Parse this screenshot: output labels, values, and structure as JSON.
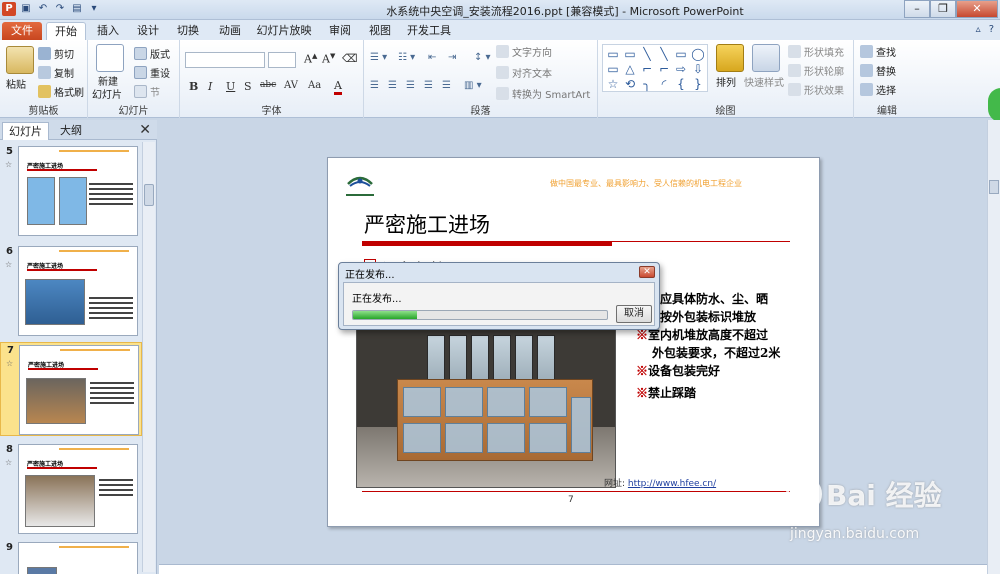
{
  "window": {
    "title": "水系统中央空调_安装流程2016.ppt [兼容模式] - Microsoft PowerPoint"
  },
  "tabs": [
    "文件",
    "开始",
    "插入",
    "设计",
    "切换",
    "动画",
    "幻灯片放映",
    "审阅",
    "视图",
    "开发工具"
  ],
  "ribbon": {
    "clipboard": {
      "paste": "粘贴",
      "cut": "剪切",
      "copy": "复制",
      "format_painter": "格式刷",
      "label": "剪贴板"
    },
    "slides": {
      "new_slide": "新建",
      "new_slide2": "幻灯片",
      "layout": "版式",
      "reset": "重设",
      "section": "节",
      "label": "幻灯片"
    },
    "font": {
      "label": "字体",
      "bold": "B",
      "italic": "I",
      "underline": "U",
      "strike": "S",
      "shadow": "abc",
      "spacing": "AV",
      "case": "Aa",
      "color": "A"
    },
    "paragraph": {
      "label": "段落",
      "text_direction": "文字方向",
      "align_text": "对齐文本",
      "smartart": "转换为 SmartArt"
    },
    "drawing": {
      "label": "绘图",
      "arrange": "排列",
      "quick_styles": "快速样式",
      "fill": "形状填充",
      "outline": "形状轮廓",
      "effects": "形状效果"
    },
    "editing": {
      "label": "编辑",
      "find": "查找",
      "replace": "替换",
      "select": "选择"
    },
    "shapes": [
      "▭",
      "▭",
      "╲",
      "╲",
      "▭",
      "◯",
      "▭",
      "△",
      "⌐",
      "⌐",
      "⇨",
      "⇩",
      "☆",
      "⟲",
      "╮",
      "◜",
      "{",
      "}"
    ]
  },
  "left_panel": {
    "tabs": [
      "幻灯片",
      "大纲"
    ],
    "slides": [
      {
        "number": "5",
        "title": "严密施工进场"
      },
      {
        "number": "6",
        "title": "严密施工进场"
      },
      {
        "number": "7",
        "title": "严密施工进场"
      },
      {
        "number": "8",
        "title": "严密施工进场"
      },
      {
        "number": "9",
        "title": ""
      }
    ]
  },
  "slide": {
    "slogan": "做中国最专业、最具影响力、受人信赖的机电工程企业",
    "title": "严密施工进场",
    "subheading": "设备保护",
    "bullets": [
      {
        "marker": "",
        "text": "堆放应具体防水、尘、晒"
      },
      {
        "marker": "",
        "text": "设备按外包装标识堆放"
      },
      {
        "marker": "※",
        "text": "室内机堆放高度不超过"
      },
      {
        "marker": "",
        "text": "外包装要求，不超过2米"
      },
      {
        "marker": "※",
        "text": "设备包装完好"
      },
      {
        "marker": "※",
        "text": "禁止踩踏"
      }
    ],
    "link_prefix": "网址:",
    "link": "http://www.hfee.cn/",
    "page_number": "7"
  },
  "dialog": {
    "title": "正在发布...",
    "message": "正在发布...",
    "cancel": "取消",
    "progress": 0.25
  },
  "watermark": {
    "brand": "Bai 经验",
    "url": "jingyan.baidu.com"
  },
  "colors": {
    "accent_red": "#c00000",
    "file_tab": "#d24726",
    "progress": "#27a52a"
  }
}
